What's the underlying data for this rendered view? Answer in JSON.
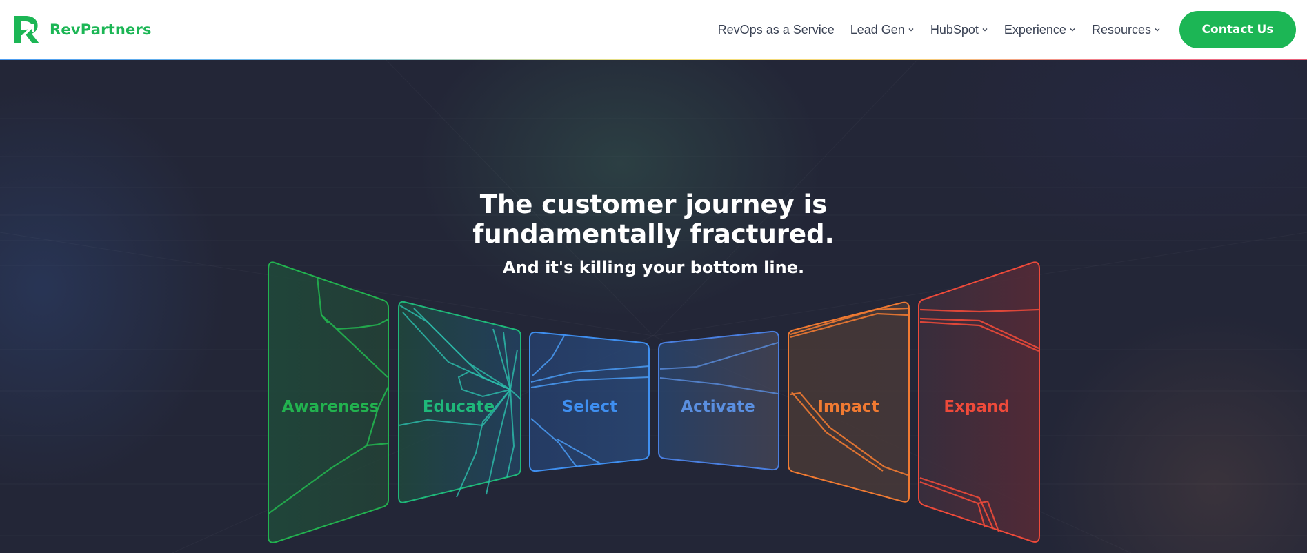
{
  "brand": {
    "name": "RevPartners",
    "color": "#1cb655"
  },
  "nav": {
    "items": [
      {
        "label": "RevOps as a Service",
        "dropdown": false
      },
      {
        "label": "Lead Gen",
        "dropdown": true
      },
      {
        "label": "HubSpot",
        "dropdown": true
      },
      {
        "label": "Experience",
        "dropdown": true
      },
      {
        "label": "Resources",
        "dropdown": true
      }
    ],
    "cta_label": "Contact Us"
  },
  "hero": {
    "headline_line1": "The customer journey is",
    "headline_line2": "fundamentally fractured.",
    "subheadline": "And it's killing your bottom line.",
    "stages": [
      {
        "label": "Awareness",
        "color": "#22b24f",
        "icon": "shattered-panel"
      },
      {
        "label": "Educate",
        "color": "#1fb87a",
        "icon": "shattered-panel"
      },
      {
        "label": "Select",
        "color": "#3f8ff0",
        "icon": "shattered-panel"
      },
      {
        "label": "Activate",
        "color": "#5a8fe0",
        "icon": "shattered-panel"
      },
      {
        "label": "Impact",
        "color": "#f07a32",
        "icon": "shattered-panel"
      },
      {
        "label": "Expand",
        "color": "#ee4a3a",
        "icon": "shattered-panel"
      }
    ]
  }
}
